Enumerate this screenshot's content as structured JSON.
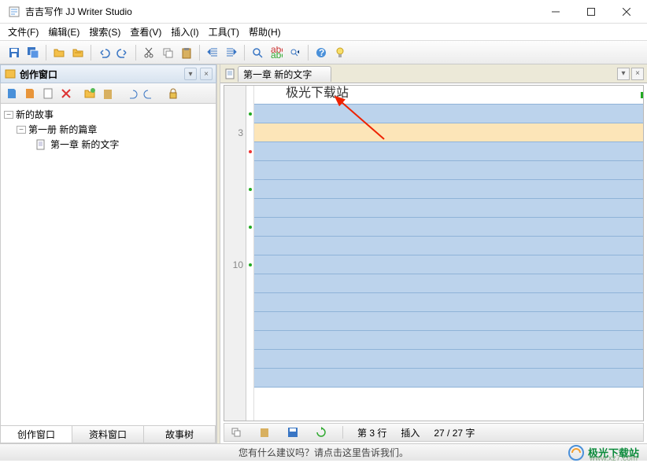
{
  "window": {
    "title": "吉吉写作 JJ Writer Studio"
  },
  "menu": {
    "file": "文件(F)",
    "edit": "编辑(E)",
    "search": "搜索(S)",
    "view": "查看(V)",
    "insert": "插入(I)",
    "tools": "工具(T)",
    "help": "帮助(H)"
  },
  "sidepanel": {
    "title": "创作窗口",
    "tree": {
      "root": "新的故事",
      "book": "第一册 新的篇章",
      "chapter": "第一章 新的文字"
    },
    "tabs": {
      "compose": "创作窗口",
      "resource": "资料窗口",
      "storytree": "故事树"
    }
  },
  "document": {
    "tab_label": "第一章 新的文字",
    "first_line_text": "极光下载站",
    "line_markers": {
      "three": "3",
      "ten": "10"
    }
  },
  "editor_status": {
    "line_label": "第 3 行",
    "mode": "插入",
    "chars": "27 / 27 字"
  },
  "statusbar": {
    "tip": "您有什么建议吗？请点击这里告诉我们。"
  },
  "brand": {
    "name": "极光下载站",
    "url": "www.xz7.com"
  }
}
